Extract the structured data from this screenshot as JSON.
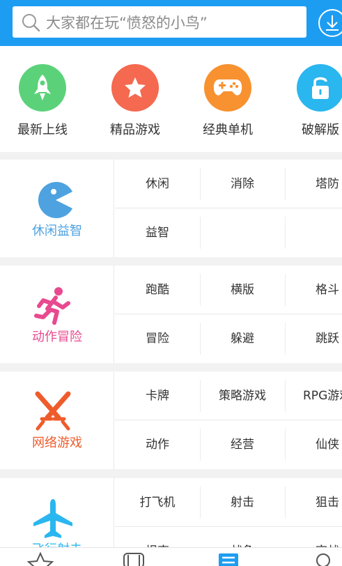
{
  "search": {
    "placeholder": "大家都在玩“愤怒的小鸟”"
  },
  "colors": {
    "header": "#1d9df2",
    "green": "#5bd27a",
    "orange_red": "#f4694f",
    "orange": "#f8912f",
    "blue": "#2ab6ef",
    "casual": "#4ea2e0",
    "action": "#e8498f",
    "online": "#ef5c2c",
    "flight": "#2ab6ef"
  },
  "quick_links": [
    {
      "label": "最新上线",
      "icon": "rocket-icon"
    },
    {
      "label": "精品游戏",
      "icon": "star-icon"
    },
    {
      "label": "经典单机",
      "icon": "gamepad-icon"
    },
    {
      "label": "破解版",
      "icon": "unlock-icon"
    }
  ],
  "categories": [
    {
      "name": "休闲益智",
      "icon": "pacman-icon",
      "tags": [
        "休闲",
        "消除",
        "塔防",
        "益智"
      ]
    },
    {
      "name": "动作冒险",
      "icon": "runner-icon",
      "tags": [
        "跑酷",
        "横版",
        "格斗",
        "冒险",
        "躲避",
        "跳跃"
      ]
    },
    {
      "name": "网络游戏",
      "icon": "crossed-swords-icon",
      "tags": [
        "卡牌",
        "策略游戏",
        "RPG游戏",
        "动作",
        "经营",
        "仙侠"
      ]
    },
    {
      "name": "飞行射击",
      "icon": "airplane-icon",
      "tags": [
        "打飞机",
        "射击",
        "狙击",
        "坦克",
        "战争",
        "空战"
      ]
    }
  ],
  "tabs": [
    {
      "icon": "star-outline-icon"
    },
    {
      "icon": "gamepad-outline-icon"
    },
    {
      "icon": "list-icon"
    },
    {
      "icon": "profile-icon"
    }
  ]
}
